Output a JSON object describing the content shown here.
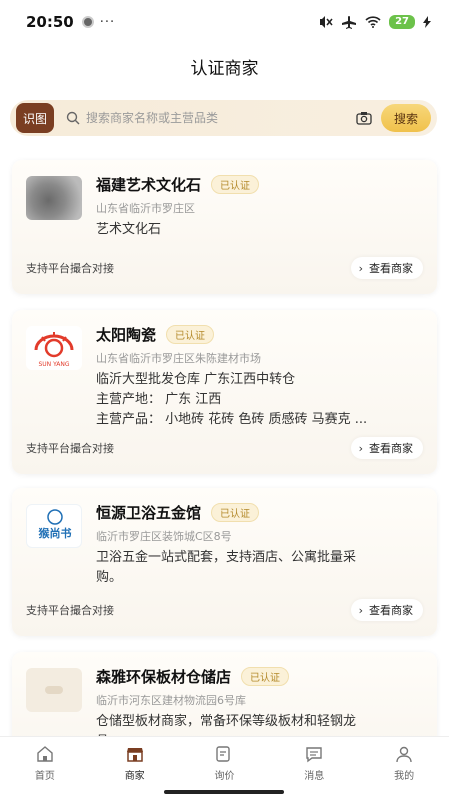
{
  "status_bar": {
    "time": "20:50",
    "dots": "···",
    "battery": "27",
    "icons": [
      "mute-icon",
      "airplane-icon",
      "wifi-icon",
      "battery-icon",
      "charging-icon"
    ]
  },
  "header": {
    "title": "认证商家"
  },
  "search": {
    "scan_label": "识图",
    "placeholder": "搜索商家名称或主营品类",
    "button_label": "搜索"
  },
  "merchants": [
    {
      "name": "福建艺术文化石",
      "badge": "已认证",
      "address": "山东省临沂市罗庄区",
      "lines": [
        "艺术文化石"
      ],
      "support": "支持平台撮合对接",
      "view_label": "查看商家",
      "chev": "›"
    },
    {
      "name": "太阳陶瓷",
      "badge": "已认证",
      "address": "山东省临沂市罗庄区朱陈建材市场",
      "lines": [
        "临沂大型批发仓库 广东江西中转仓",
        "主营产地：  广东  江西",
        "主营产品：  小地砖  花砖  色砖  质感砖  马赛克  ..."
      ],
      "support": "支持平台撮合对接",
      "view_label": "查看商家",
      "chev": "›"
    },
    {
      "name": "恒源卫浴五金馆",
      "badge": "已认证",
      "address": "临沂市罗庄区装饰城C区8号",
      "lines": [
        "卫浴五金一站式配套，支持酒店、公寓批量采",
        "购。"
      ],
      "support": "支持平台撮合对接",
      "view_label": "查看商家",
      "chev": "›"
    },
    {
      "name": "森雅环保板材仓储店",
      "badge": "已认证",
      "address": "临沂市河东区建材物流园6号库",
      "lines": [
        "仓储型板材商家，常备环保等级板材和轻钢龙",
        "骨。"
      ],
      "support": "",
      "view_label": "",
      "chev": ""
    }
  ],
  "logos": {
    "m2_text": "猴尚书",
    "m1_caption": "SUN YANG"
  },
  "tabs": [
    {
      "label": "首页",
      "icon": "home-icon"
    },
    {
      "label": "商家",
      "icon": "shop-icon",
      "active": true
    },
    {
      "label": "询价",
      "icon": "inquiry-icon"
    },
    {
      "label": "消息",
      "icon": "message-icon"
    },
    {
      "label": "我的",
      "icon": "profile-icon"
    }
  ],
  "colors": {
    "accent": "#7a3e22",
    "search_btn": "#f0c14b",
    "badge": "#b48a2c",
    "battery": "#6cc24a"
  }
}
